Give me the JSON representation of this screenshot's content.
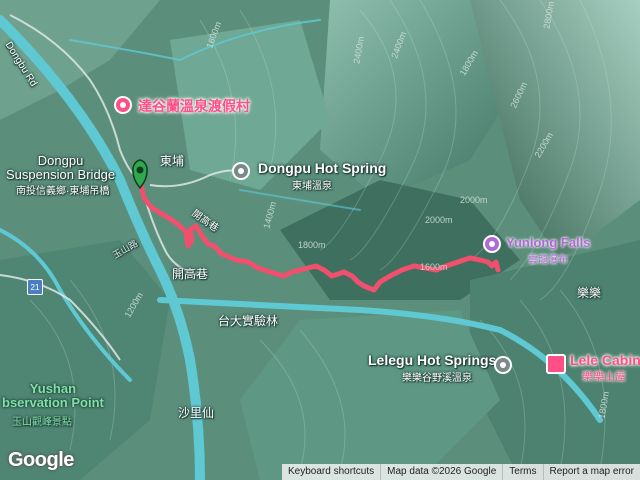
{
  "colors": {
    "track": "#f0506e",
    "river": "#5fc9d3",
    "terrain": "#5b8f7c",
    "poi_pink": "#ff4f86"
  },
  "roads": {
    "dongbu_rd": "Dongbu Rd",
    "kaigao_lane_vertical": "開高巷",
    "kaigao_lane": "開高巷",
    "route_21": "21",
    "road_21_label": "玉山路"
  },
  "places": {
    "dongpu": "東埔",
    "taida_forest": "台大實驗林",
    "shalixian": "沙里仙",
    "lele": "樂樂",
    "dongpu_bridge_en": "Dongpu\nSuspension Bridge",
    "dongpu_bridge_zh": "南投信義鄉·東埔吊橋",
    "yushan_obs_en": "Yushan\nbservation Point",
    "yushan_obs_zh": "玉山觀峰景點"
  },
  "pois": {
    "resort": "達谷蘭溫泉渡假村",
    "dongpu_hot_spring_en": "Dongpu Hot Spring",
    "dongpu_hot_spring_zh": "東埔溫泉",
    "yunlong_falls_en": "Yunlong Falls",
    "yunlong_falls_zh": "雲龍瀑布",
    "lelegu_en": "Lelegu Hot Springs",
    "lelegu_zh": "樂樂谷野溪溫泉",
    "lele_cabin_en": "Lele Cabin",
    "lele_cabin_zh": "樂樂山屋"
  },
  "contours": [
    "1600m",
    "1800m",
    "2000m",
    "2200m",
    "2400m",
    "2600m",
    "2800m",
    "1400m",
    "1200m",
    "1800m",
    "2000m",
    "2400m",
    "1800m",
    "1600m"
  ],
  "footer": {
    "shortcuts": "Keyboard shortcuts",
    "map_data": "Map data ©2026 Google",
    "terms": "Terms",
    "report": "Report a map error"
  },
  "logo": "Google",
  "icons": [
    "start-pin-icon",
    "resort-icon",
    "hot-spring-icon",
    "camera-icon",
    "cabin-icon"
  ]
}
